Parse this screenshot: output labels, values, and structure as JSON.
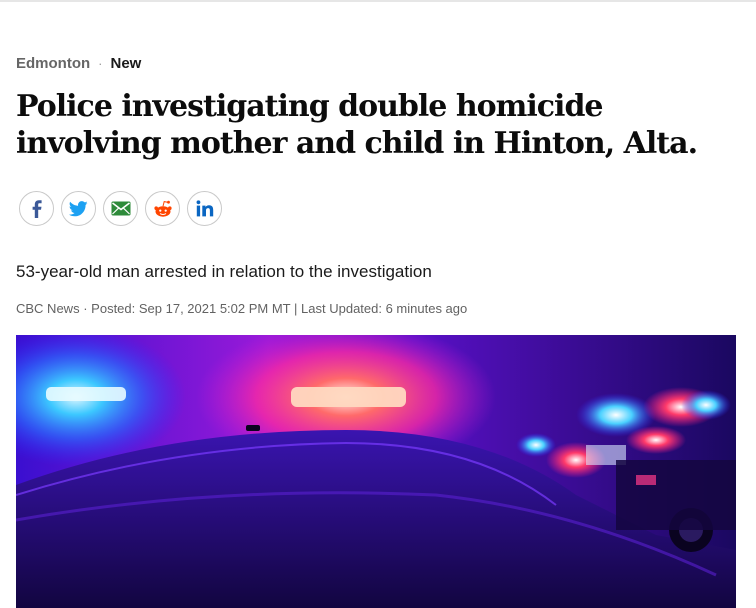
{
  "breadcrumb": {
    "section": "Edmonton",
    "separator": "·",
    "tag": "New"
  },
  "article": {
    "headline": "Police investigating double homicide involving mother and child in Hinton, Alta.",
    "deck": "53-year-old man arrested in relation to the investigation",
    "byline": {
      "source": "CBC News",
      "sep1": "·",
      "posted": "Posted: Sep 17, 2021 5:02 PM MT",
      "sep2": "|",
      "updated": "Last Updated: 6 minutes ago"
    }
  },
  "share": [
    {
      "network": "facebook",
      "icon": "facebook-icon",
      "color": "#3b5998"
    },
    {
      "network": "twitter",
      "icon": "twitter-icon",
      "color": "#1da1f2"
    },
    {
      "network": "email",
      "icon": "email-icon",
      "color": "#2e8b3a"
    },
    {
      "network": "reddit",
      "icon": "reddit-icon",
      "color": "#ff4500"
    },
    {
      "network": "linkedin",
      "icon": "linkedin-icon",
      "color": "#0a66c2"
    }
  ],
  "hero_image": {
    "subject": "police-car-emergency-lights-at-night",
    "dominant_colors": [
      "#2a0a8a",
      "#ff2a8a",
      "#3cc8ff",
      "#5a1aff"
    ]
  }
}
